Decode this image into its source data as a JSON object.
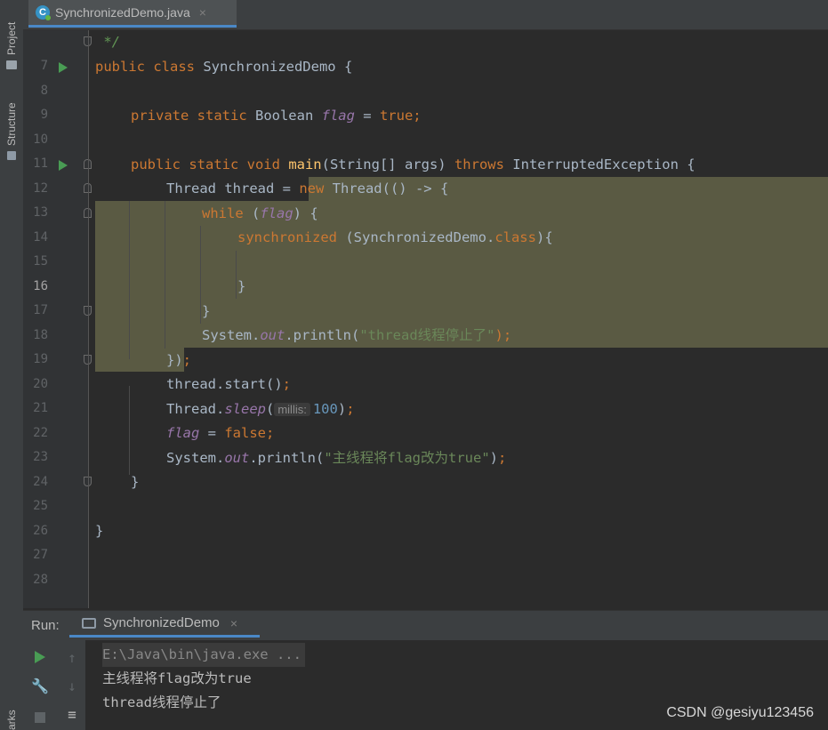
{
  "sidebar": {
    "project_label": "Project",
    "structure_label": "Structure",
    "bookmarks_label": "arks"
  },
  "editor_tab": {
    "filename": "SynchronizedDemo.java",
    "close": "×"
  },
  "code": {
    "l7": "7",
    "l7_text": " */",
    "l8": "8",
    "l8_kw": "public class ",
    "l8_name": "SynchronizedDemo {",
    "l9": "9",
    "l10": "10",
    "l10_kw": "private static ",
    "l10_type": "Boolean ",
    "l10_field": "flag",
    "l10_eq": " = ",
    "l10_val": "true",
    "l10_semi": ";",
    "l11": "11",
    "l12": "12",
    "l12_kw": "public static void ",
    "l12_fn": "main",
    "l12_args": "(String[] args) ",
    "l12_throws": "throws ",
    "l12_ex": "InterruptedException {",
    "l13": "13",
    "l13_a": "Thread thread = ",
    "l13_new": "new ",
    "l13_b": "Thread(() -> {",
    "l14": "14",
    "l14_kw": "while ",
    "l14_a": "(",
    "l14_field": "flag",
    "l14_b": ") {",
    "l15": "15",
    "l15_kw": "synchronized ",
    "l15_a": "(SynchronizedDemo.",
    "l15_cls": "class",
    "l15_b": "){",
    "l16": "16",
    "l17": "17",
    "l17_text": "}",
    "l18": "18",
    "l18_text": "}",
    "l19": "19",
    "l19_a": "System.",
    "l19_out": "out",
    "l19_b": ".println(",
    "l19_str": "\"thread线程停止了\"",
    "l19_c": ");",
    "l20": "20",
    "l20_a": "})",
    "l20_semi": ";",
    "l21": "21",
    "l21_a": "thread.start()",
    "l21_semi": ";",
    "l22": "22",
    "l22_a": "Thread.",
    "l22_fn": "sleep",
    "l22_b": "(",
    "l22_hint": "millis:",
    "l22_num": "100",
    "l22_c": ")",
    "l22_semi": ";",
    "l23": "23",
    "l23_field": "flag",
    "l23_eq": " = ",
    "l23_val": "false",
    "l23_semi": ";",
    "l24": "24",
    "l24_a": "System.",
    "l24_out": "out",
    "l24_b": ".println(",
    "l24_str": "\"主线程将flag改为true\"",
    "l24_c": ")",
    "l24_semi": ";",
    "l25": "25",
    "l25_text": "}",
    "l26": "26",
    "l27": "27",
    "l27_text": "}",
    "l28": "28"
  },
  "run": {
    "label": "Run:",
    "tab_name": "SynchronizedDemo",
    "close": "×",
    "output": [
      "E:\\Java\\bin\\java.exe ...",
      "主线程将flag改为true",
      "thread线程停止了"
    ]
  },
  "watermark": "CSDN @gesiyu123456",
  "colors": {
    "keyword": "#cc7832",
    "field": "#9876aa",
    "string": "#6a8759",
    "number": "#6897bb",
    "function": "#ffc66d",
    "highlight": "#5a5a43"
  }
}
